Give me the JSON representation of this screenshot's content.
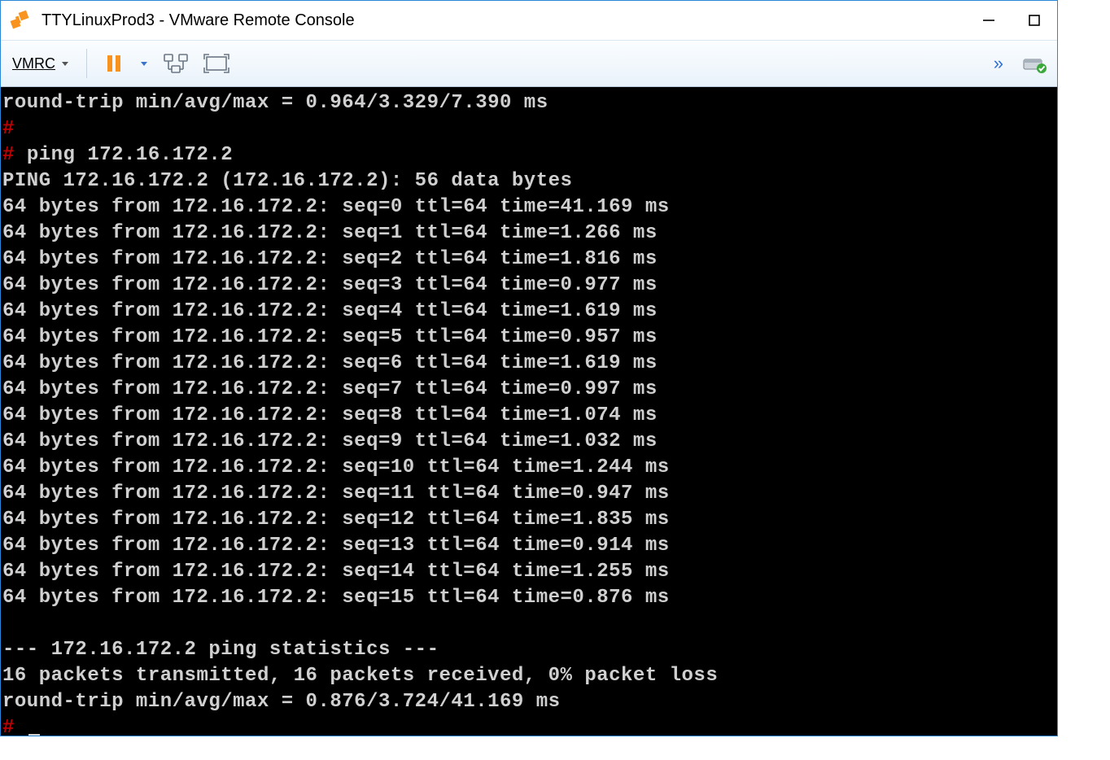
{
  "window": {
    "title": "TTYLinuxProd3 - VMware Remote Console"
  },
  "toolbar": {
    "menu_label": "VMRC"
  },
  "terminal": {
    "top_summary": "round-trip min/avg/max = 0.964/3.329/7.390 ms",
    "prompt_hash": "#",
    "command": "ping 172.16.172.2",
    "ping_header": "PING 172.16.172.2 (172.16.172.2): 56 data bytes",
    "replies": [
      "64 bytes from 172.16.172.2: seq=0 ttl=64 time=41.169 ms",
      "64 bytes from 172.16.172.2: seq=1 ttl=64 time=1.266 ms",
      "64 bytes from 172.16.172.2: seq=2 ttl=64 time=1.816 ms",
      "64 bytes from 172.16.172.2: seq=3 ttl=64 time=0.977 ms",
      "64 bytes from 172.16.172.2: seq=4 ttl=64 time=1.619 ms",
      "64 bytes from 172.16.172.2: seq=5 ttl=64 time=0.957 ms",
      "64 bytes from 172.16.172.2: seq=6 ttl=64 time=1.619 ms",
      "64 bytes from 172.16.172.2: seq=7 ttl=64 time=0.997 ms",
      "64 bytes from 172.16.172.2: seq=8 ttl=64 time=1.074 ms",
      "64 bytes from 172.16.172.2: seq=9 ttl=64 time=1.032 ms",
      "64 bytes from 172.16.172.2: seq=10 ttl=64 time=1.244 ms",
      "64 bytes from 172.16.172.2: seq=11 ttl=64 time=0.947 ms",
      "64 bytes from 172.16.172.2: seq=12 ttl=64 time=1.835 ms",
      "64 bytes from 172.16.172.2: seq=13 ttl=64 time=0.914 ms",
      "64 bytes from 172.16.172.2: seq=14 ttl=64 time=1.255 ms",
      "64 bytes from 172.16.172.2: seq=15 ttl=64 time=0.876 ms"
    ],
    "stats_header": "--- 172.16.172.2 ping statistics ---",
    "stats_line1": "16 packets transmitted, 16 packets received, 0% packet loss",
    "stats_line2": "round-trip min/avg/max = 0.876/3.724/41.169 ms"
  }
}
